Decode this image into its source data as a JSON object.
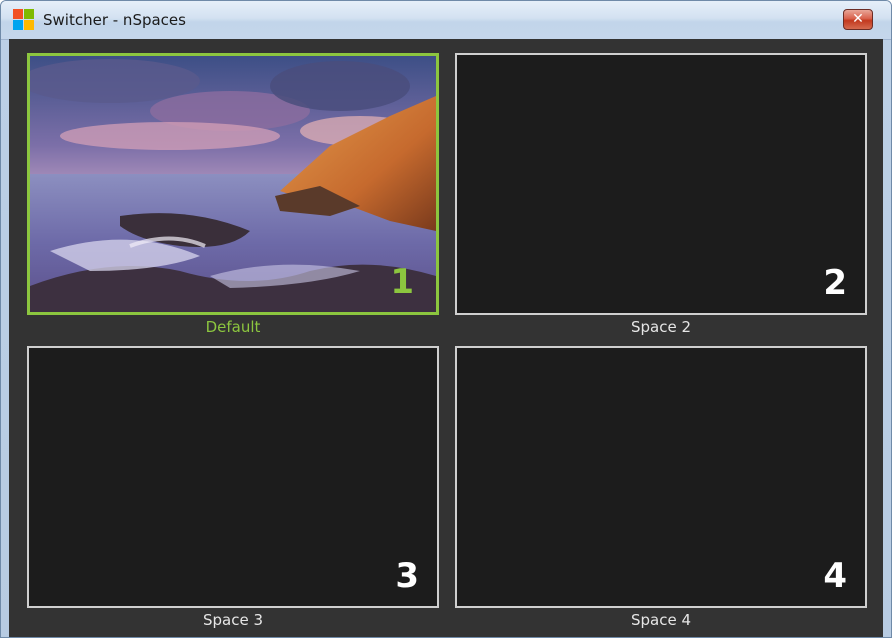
{
  "window": {
    "title": "Switcher - nSpaces",
    "close_label": "✕",
    "icon": "windows-logo-icon"
  },
  "colors": {
    "active_accent": "#8cc63f",
    "tile_background": "#1c1c1c",
    "client_background": "#333333"
  },
  "spaces": [
    {
      "number": "1",
      "label": "Default",
      "active": true,
      "has_wallpaper": true
    },
    {
      "number": "2",
      "label": "Space 2",
      "active": false,
      "has_wallpaper": false
    },
    {
      "number": "3",
      "label": "Space 3",
      "active": false,
      "has_wallpaper": false
    },
    {
      "number": "4",
      "label": "Space 4",
      "active": false,
      "has_wallpaper": false
    }
  ]
}
